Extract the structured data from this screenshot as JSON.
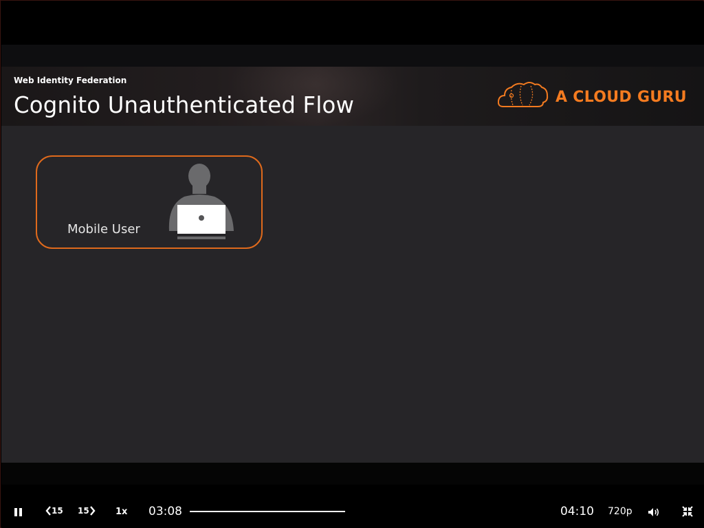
{
  "slide": {
    "subtitle": "Web Identity Federation",
    "title": "Cognito Unauthenticated Flow",
    "brand": {
      "name": "A CLOUD GURU",
      "icon": "cloud-logo-icon",
      "color": "#f47b20"
    },
    "user_card": {
      "label": "Mobile User",
      "icon": "user-with-laptop-icon",
      "border_color": "#e06a1c"
    },
    "background_color": "#262528"
  },
  "player": {
    "playing": true,
    "pause_icon": "pause-icon",
    "rewind_label": "15",
    "rewind_icon": "chevron-left-icon",
    "forward_label": "15",
    "forward_icon": "chevron-right-icon",
    "speed_label": "1x",
    "current_time": "03:08",
    "duration": "04:10",
    "quality_label": "720p",
    "volume_icon": "volume-icon",
    "exit_fullscreen_icon": "exit-fullscreen-icon"
  }
}
